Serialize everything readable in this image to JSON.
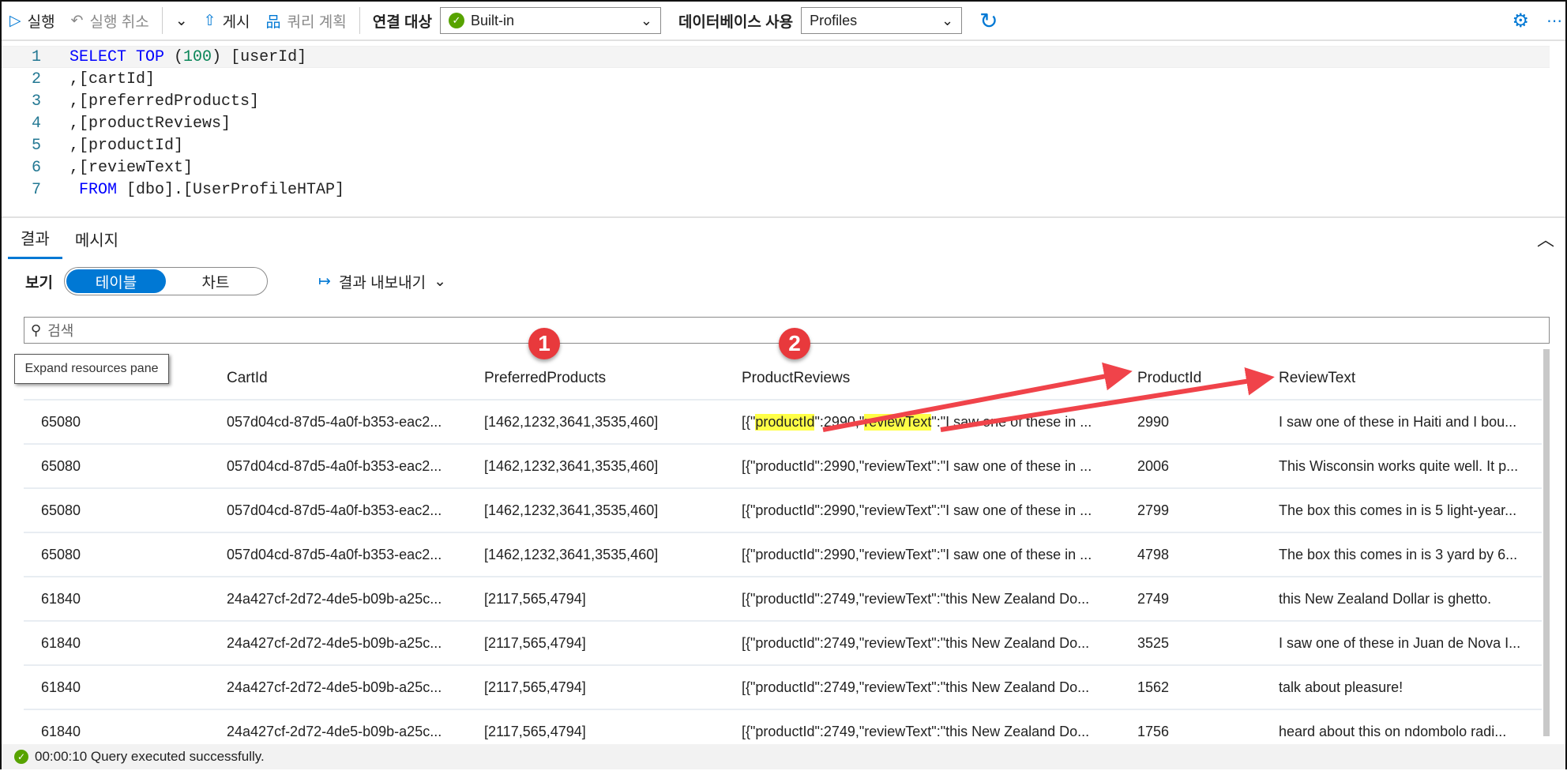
{
  "toolbar": {
    "run": "실행",
    "undo": "실행 취소",
    "publish": "게시",
    "query_plan": "쿼리 계획",
    "connect_label": "연결 대상",
    "connection": "Built-in",
    "db_label": "데이터베이스 사용",
    "database": "Profiles"
  },
  "code": [
    {
      "n": "1",
      "parts": [
        [
          "kw",
          "SELECT TOP "
        ],
        [
          "",
          "("
        ],
        [
          "num",
          "100"
        ],
        [
          "",
          ") [userId]"
        ]
      ]
    },
    {
      "n": "2",
      "parts": [
        [
          "",
          ",[cartId]"
        ]
      ]
    },
    {
      "n": "3",
      "parts": [
        [
          "",
          ",[preferredProducts]"
        ]
      ]
    },
    {
      "n": "4",
      "parts": [
        [
          "",
          ",[productReviews]"
        ]
      ]
    },
    {
      "n": "5",
      "parts": [
        [
          "",
          ",[productId]"
        ]
      ]
    },
    {
      "n": "6",
      "parts": [
        [
          "",
          ",[reviewText]"
        ]
      ]
    },
    {
      "n": "7",
      "parts": [
        [
          "kw",
          " FROM "
        ],
        [
          "",
          "[dbo].[UserProfileHTAP]"
        ]
      ]
    }
  ],
  "results": {
    "tab_results": "결과",
    "tab_messages": "메시지",
    "view_label": "보기",
    "view_table": "테이블",
    "view_chart": "차트",
    "export": "결과 내보내기",
    "search_placeholder": "검색",
    "tooltip": "Expand resources pane"
  },
  "table": {
    "columns": [
      "",
      "CartId",
      "PreferredProducts",
      "ProductReviews",
      "ProductId",
      "ReviewText"
    ],
    "rows": [
      [
        "65080",
        "057d04cd-87d5-4a0f-b353-eac2...",
        "[1462,1232,3641,3535,460]",
        "[{\"productId\":2990,\"reviewText\":\"I saw one of these in ...",
        "2990",
        "I saw one of these in Haiti and I bou..."
      ],
      [
        "65080",
        "057d04cd-87d5-4a0f-b353-eac2...",
        "[1462,1232,3641,3535,460]",
        "[{\"productId\":2990,\"reviewText\":\"I saw one of these in ...",
        "2006",
        "This Wisconsin works quite well. It p..."
      ],
      [
        "65080",
        "057d04cd-87d5-4a0f-b353-eac2...",
        "[1462,1232,3641,3535,460]",
        "[{\"productId\":2990,\"reviewText\":\"I saw one of these in ...",
        "2799",
        "The box this comes in is 5 light-year..."
      ],
      [
        "65080",
        "057d04cd-87d5-4a0f-b353-eac2...",
        "[1462,1232,3641,3535,460]",
        "[{\"productId\":2990,\"reviewText\":\"I saw one of these in ...",
        "4798",
        "The box this comes in is 3 yard by 6..."
      ],
      [
        "61840",
        "24a427cf-2d72-4de5-b09b-a25c...",
        "[2117,565,4794]",
        "[{\"productId\":2749,\"reviewText\":\"this New Zealand Do...",
        "2749",
        "this New Zealand Dollar is ghetto."
      ],
      [
        "61840",
        "24a427cf-2d72-4de5-b09b-a25c...",
        "[2117,565,4794]",
        "[{\"productId\":2749,\"reviewText\":\"this New Zealand Do...",
        "3525",
        "I saw one of these in Juan de Nova I..."
      ],
      [
        "61840",
        "24a427cf-2d72-4de5-b09b-a25c...",
        "[2117,565,4794]",
        "[{\"productId\":2749,\"reviewText\":\"this New Zealand Do...",
        "1562",
        "talk about pleasure!"
      ],
      [
        "61840",
        "24a427cf-2d72-4de5-b09b-a25c...",
        "[2117,565,4794]",
        "[{\"productId\":2749,\"reviewText\":\"this New Zealand Do...",
        "1756",
        "heard about this on ndombolo radi..."
      ]
    ],
    "highlight_parts": {
      "pre": "[{\"",
      "key1": "productId",
      "mid": "\":2990,\"",
      "key2": "reviewText",
      "post": "\":\"I saw one of these in ..."
    }
  },
  "annotations": {
    "badge1": "1",
    "badge2": "2",
    "color": "#e8393c"
  },
  "status": {
    "text": "00:00:10 Query executed successfully."
  }
}
